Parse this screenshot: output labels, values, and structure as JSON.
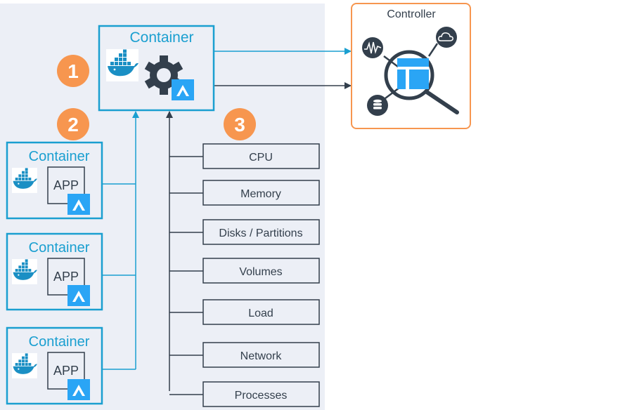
{
  "colors": {
    "accent_blue": "#1a9fd0",
    "badge_blue": "#2aa5f5",
    "dark": "#333f4c",
    "orange": "#f7964f",
    "panel_bg": "#eceff6",
    "docker_blue": "#1a8fc4"
  },
  "main_container": {
    "title": "Container",
    "icons": [
      "docker-whale-icon",
      "gear-icon",
      "rancher-badge-icon"
    ]
  },
  "steps": [
    "1",
    "2",
    "3"
  ],
  "controller": {
    "title": "Controller",
    "icons": [
      "pulse-icon",
      "cloud-icon",
      "database-icon",
      "dashboard-icon",
      "magnifier-icon"
    ]
  },
  "app_containers": [
    {
      "title": "Container",
      "app": "APP"
    },
    {
      "title": "Container",
      "app": "APP"
    },
    {
      "title": "Container",
      "app": "APP"
    }
  ],
  "metrics": [
    "CPU",
    "Memory",
    "Disks / Partitions",
    "Volumes",
    "Load",
    "Network",
    "Processes"
  ]
}
